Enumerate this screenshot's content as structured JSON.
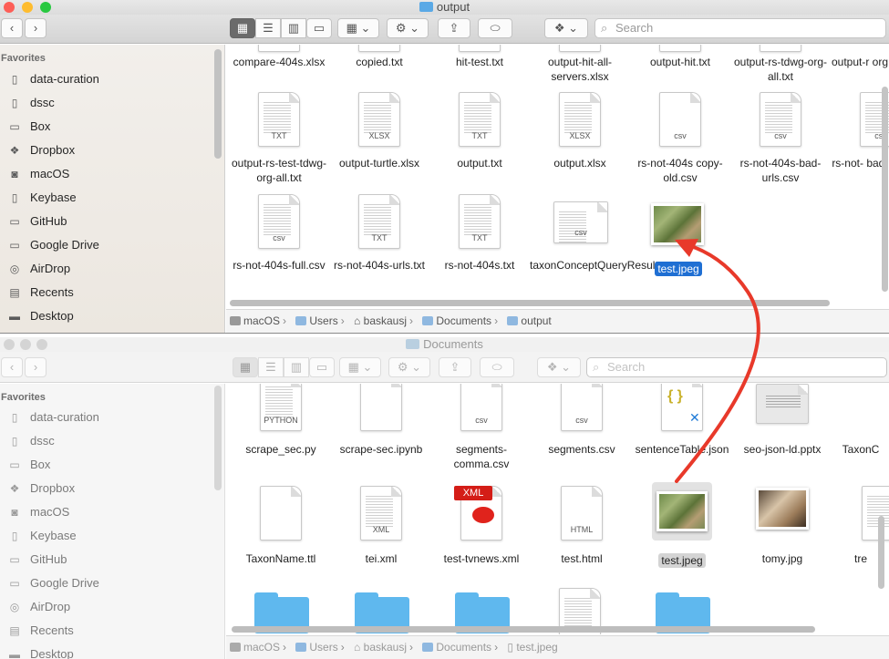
{
  "window1": {
    "title": "output",
    "search_placeholder": "Search",
    "favorites_header": "Favorites",
    "sidebar": [
      {
        "label": "data-curation",
        "icon": "document-icon"
      },
      {
        "label": "dssc",
        "icon": "document-icon"
      },
      {
        "label": "Box",
        "icon": "folder-icon"
      },
      {
        "label": "Dropbox",
        "icon": "dropbox-icon"
      },
      {
        "label": "macOS",
        "icon": "disk-icon"
      },
      {
        "label": "Keybase",
        "icon": "document-icon"
      },
      {
        "label": "GitHub",
        "icon": "folder-icon"
      },
      {
        "label": "Google Drive",
        "icon": "folder-icon"
      },
      {
        "label": "AirDrop",
        "icon": "airdrop-icon"
      },
      {
        "label": "Recents",
        "icon": "recents-icon"
      },
      {
        "label": "Desktop",
        "icon": "desktop-icon"
      }
    ],
    "files_row0": [
      "compare-404s.xlsx",
      "copied.txt",
      "hit-test.txt",
      "output-hit-all-servers.xlsx",
      "output-hit.txt",
      "output-rs-tdwg-org-all.txt",
      "output-r org"
    ],
    "files_row1": [
      {
        "name": "output-rs-test-tdwg-org-all.txt",
        "ext": "TXT"
      },
      {
        "name": "output-turtle.xlsx",
        "ext": "XLSX"
      },
      {
        "name": "output.txt",
        "ext": "TXT"
      },
      {
        "name": "output.xlsx",
        "ext": "XLSX"
      },
      {
        "name": "rs-not-404s copy-old.csv",
        "ext": "csv"
      },
      {
        "name": "rs-not-404s-bad-urls.csv",
        "ext": "csv"
      },
      {
        "name": "rs-not- bad.",
        "ext": "csv"
      }
    ],
    "files_row2": [
      {
        "name": "rs-not-404s-full.csv",
        "ext": "csv"
      },
      {
        "name": "rs-not-404s-urls.txt",
        "ext": "TXT"
      },
      {
        "name": "rs-not-404s.txt",
        "ext": "TXT"
      },
      {
        "name": "taxonConceptQueryResults.csv",
        "ext": "csv"
      }
    ],
    "selected_file": "test.jpeg",
    "path": [
      "macOS",
      "Users",
      "baskausj",
      "Documents",
      "output"
    ]
  },
  "window2": {
    "title": "Documents",
    "search_placeholder": "Search",
    "favorites_header": "Favorites",
    "sidebar": [
      {
        "label": "data-curation",
        "icon": "document-icon"
      },
      {
        "label": "dssc",
        "icon": "document-icon"
      },
      {
        "label": "Box",
        "icon": "folder-icon"
      },
      {
        "label": "Dropbox",
        "icon": "dropbox-icon"
      },
      {
        "label": "macOS",
        "icon": "disk-icon"
      },
      {
        "label": "Keybase",
        "icon": "document-icon"
      },
      {
        "label": "GitHub",
        "icon": "folder-icon"
      },
      {
        "label": "Google Drive",
        "icon": "folder-icon"
      },
      {
        "label": "AirDrop",
        "icon": "airdrop-icon"
      },
      {
        "label": "Recents",
        "icon": "recents-icon"
      },
      {
        "label": "Desktop",
        "icon": "desktop-icon"
      }
    ],
    "files_row1": [
      {
        "name": "scrape_sec.py",
        "ext": "PYTHON"
      },
      {
        "name": "scrape-sec.ipynb",
        "ext": ""
      },
      {
        "name": "segments-comma.csv",
        "ext": "csv"
      },
      {
        "name": "segments.csv",
        "ext": "csv"
      },
      {
        "name": "sentenceTable.json",
        "ext": "{ }"
      },
      {
        "name": "seo-json-ld.pptx",
        "ext": ""
      },
      {
        "name": "TaxonC",
        "ext": ""
      }
    ],
    "files_row2": [
      {
        "name": "TaxonName.ttl",
        "ext": ""
      },
      {
        "name": "tei.xml",
        "ext": "XML"
      },
      {
        "name": "test-tvnews.xml",
        "ext": "XML"
      },
      {
        "name": "test.html",
        "ext": "HTML"
      },
      {
        "name": "test.jpeg",
        "ext": ""
      },
      {
        "name": "tomy.jpg",
        "ext": ""
      },
      {
        "name": "tre",
        "ext": ""
      }
    ],
    "path": [
      "macOS",
      "Users",
      "baskausj",
      "Documents",
      "test.jpeg"
    ]
  },
  "colors": {
    "arrow": "#e8392a",
    "selection": "#1f6fd3",
    "folder": "#5fb8ee"
  }
}
